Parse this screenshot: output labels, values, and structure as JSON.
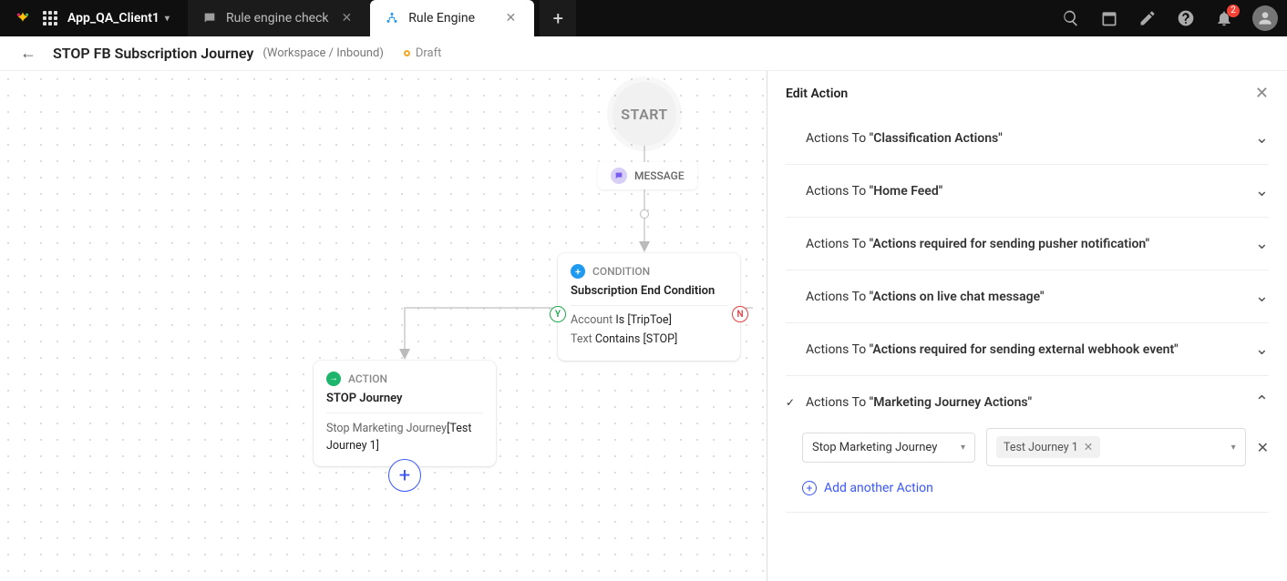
{
  "appbar": {
    "client_name": "App_QA_Client1",
    "tabs": [
      {
        "label": "Rule engine check",
        "active": false
      },
      {
        "label": "Rule Engine",
        "active": true
      }
    ],
    "notification_count": "2"
  },
  "subheader": {
    "title": "STOP FB Subscription Journey",
    "crumb": "(Workspace / Inbound)",
    "status": "Draft"
  },
  "flow": {
    "start_label": "START",
    "message_label": "MESSAGE",
    "condition": {
      "type": "CONDITION",
      "name": "Subscription End Condition",
      "rows": [
        {
          "field": "Account",
          "op": "Is",
          "value": "[TripToe]"
        },
        {
          "field": "Text",
          "op": "Contains",
          "value": "[STOP]"
        }
      ],
      "yes_badge": "Y",
      "no_badge": "N"
    },
    "action": {
      "type": "ACTION",
      "name": "STOP Journey",
      "row_field": "Stop Marketing Journey",
      "row_value": "[Test Journey 1]"
    },
    "add_button": "+"
  },
  "panel": {
    "title": "Edit Action",
    "prefix": "Actions To",
    "items": [
      {
        "label": "Classification Actions",
        "expanded": false
      },
      {
        "label": "Home Feed",
        "expanded": false
      },
      {
        "label": "Actions required for sending pusher notification",
        "expanded": false
      },
      {
        "label": "Actions on live chat message",
        "expanded": false
      },
      {
        "label": "Actions required for sending external webhook event",
        "expanded": false
      },
      {
        "label": "Marketing Journey Actions",
        "expanded": true,
        "completed": true
      }
    ],
    "expanded_body": {
      "select_value": "Stop Marketing Journey",
      "chip_value": "Test Journey 1",
      "add_label": "Add another Action"
    }
  }
}
